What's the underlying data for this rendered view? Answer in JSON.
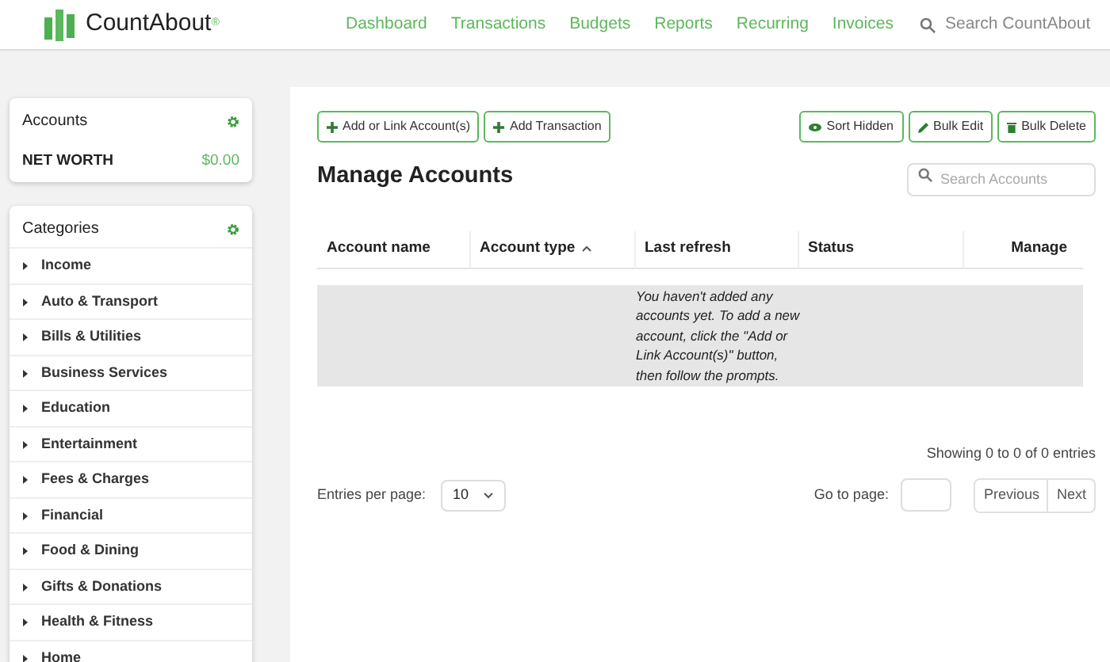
{
  "brand": {
    "name": "CountAbout",
    "mark": "®"
  },
  "nav": [
    {
      "label": "Dashboard"
    },
    {
      "label": "Transactions"
    },
    {
      "label": "Budgets"
    },
    {
      "label": "Reports"
    },
    {
      "label": "Recurring"
    },
    {
      "label": "Invoices"
    }
  ],
  "site_search": {
    "placeholder": "Search CountAbout"
  },
  "accounts_panel": {
    "title": "Accounts",
    "net_worth_label": "NET WORTH",
    "net_worth_value": "$0.00"
  },
  "categories_panel": {
    "title": "Categories",
    "items": [
      {
        "label": "Income"
      },
      {
        "label": "Auto & Transport"
      },
      {
        "label": "Bills & Utilities"
      },
      {
        "label": "Business Services"
      },
      {
        "label": "Education"
      },
      {
        "label": "Entertainment"
      },
      {
        "label": "Fees & Charges"
      },
      {
        "label": "Financial"
      },
      {
        "label": "Food & Dining"
      },
      {
        "label": "Gifts & Donations"
      },
      {
        "label": "Health & Fitness"
      },
      {
        "label": "Home"
      }
    ]
  },
  "toolbar_left": [
    {
      "label": "Add or Link Account(s)",
      "kind": "add"
    },
    {
      "label": "Add Transaction",
      "kind": "add"
    }
  ],
  "toolbar_right": [
    {
      "label": "Sort Hidden",
      "kind": "view"
    },
    {
      "label": "Bulk Edit",
      "kind": "edit"
    },
    {
      "label": "Bulk Delete",
      "kind": "delete"
    }
  ],
  "title": "Manage Accounts",
  "account_search": {
    "placeholder": "Search Accounts"
  },
  "table": {
    "columns": [
      {
        "label": "Account name",
        "sorted": false
      },
      {
        "label": "Account type",
        "sorted": true
      },
      {
        "label": "Last refresh",
        "sorted": false
      },
      {
        "label": "Status",
        "sorted": false
      },
      {
        "label": "Manage",
        "sorted": false
      }
    ],
    "empty_message": "You haven't added any accounts yet. To add a new account, click the \"Add or Link Account(s)\" button, then follow the prompts."
  },
  "info": "Showing 0 to 0 of 0 entries",
  "entries_per_page": {
    "label": "Entries per page:",
    "value": "10"
  },
  "goto": {
    "label": "Go to page:"
  },
  "pager": [
    {
      "label": "Previous"
    },
    {
      "label": "Next"
    }
  ]
}
